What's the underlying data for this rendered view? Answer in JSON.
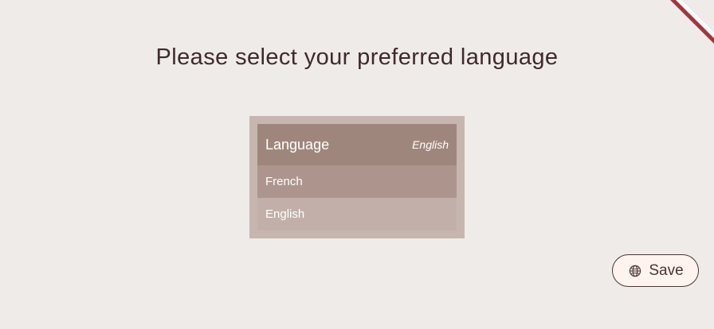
{
  "header": {
    "title": "Please select your preferred language"
  },
  "language_selector": {
    "label": "Language",
    "selected_value": "English",
    "options": [
      {
        "label": "French"
      },
      {
        "label": "English"
      }
    ]
  },
  "actions": {
    "save_label": "Save",
    "save_icon": "globe-icon"
  },
  "colors": {
    "background": "#efebe8",
    "title_text": "#3f2a2a",
    "panel_border": "#c7b6b0",
    "header_bg": "#9f867c",
    "french_bg": "#ad958d",
    "english_bg": "#c2afaa",
    "button_bg": "#fff3ef",
    "button_border": "#4a3636",
    "ribbon_red": "#a1373a"
  }
}
